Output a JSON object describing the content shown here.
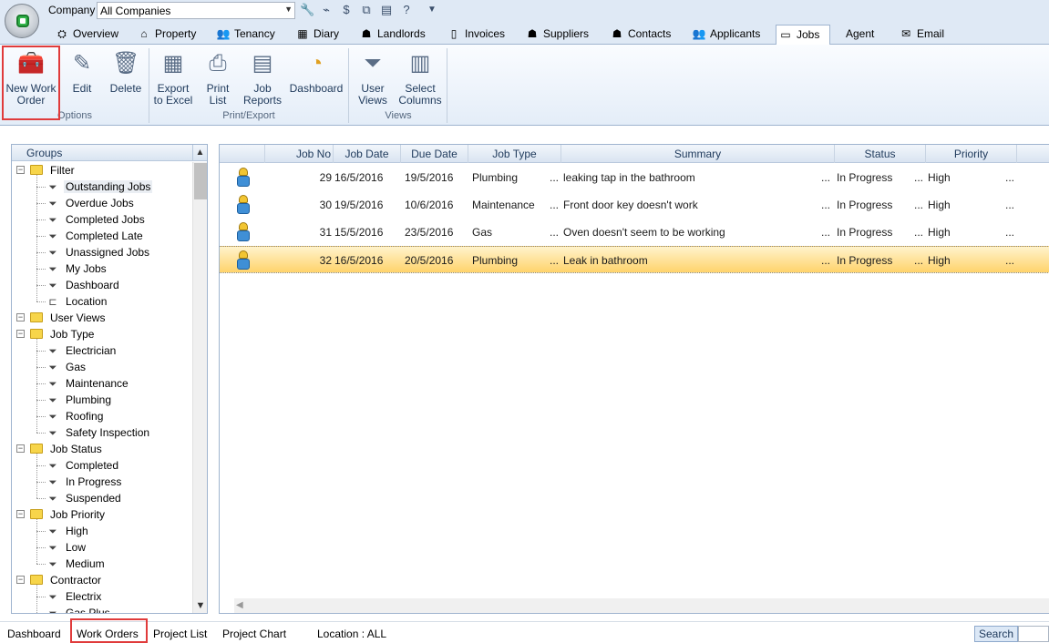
{
  "topbar": {
    "company_label": "Company",
    "company_value": "All Companies",
    "quick_access": [
      "wrench-icon",
      "tag-icon",
      "money-icon",
      "tree-icon",
      "document-icon",
      "help-icon",
      "customize-icon"
    ]
  },
  "tabs": [
    {
      "label": "Overview",
      "icon": "overview-icon"
    },
    {
      "label": "Property",
      "icon": "property-icon"
    },
    {
      "label": "Tenancy",
      "icon": "tenancy-icon"
    },
    {
      "label": "Diary",
      "icon": "diary-icon"
    },
    {
      "label": "Landlords",
      "icon": "landlords-icon"
    },
    {
      "label": "Invoices",
      "icon": "invoices-icon"
    },
    {
      "label": "Suppliers",
      "icon": "suppliers-icon"
    },
    {
      "label": "Contacts",
      "icon": "contacts-icon"
    },
    {
      "label": "Applicants",
      "icon": "applicants-icon"
    },
    {
      "label": "Jobs",
      "icon": "jobs-icon",
      "active": true
    },
    {
      "label": "Agent",
      "icon": ""
    },
    {
      "label": "Email",
      "icon": "email-icon"
    }
  ],
  "ribbon": {
    "new_work_order": "New Work\nOrder",
    "edit": "Edit",
    "delete": "Delete",
    "export_excel": "Export\nto Excel",
    "print_list": "Print\nList",
    "job_reports": "Job\nReports",
    "dashboard": "Dashboard",
    "user_views": "User\nViews",
    "select_columns": "Select\nColumns",
    "group_options": "Options",
    "group_print_export": "Print/Export",
    "group_views": "Views"
  },
  "groups": {
    "header": "Groups",
    "nodes": [
      {
        "label": "Filter",
        "type": "folder",
        "level": 0
      },
      {
        "label": "Outstanding Jobs",
        "type": "filter",
        "level": 1,
        "selected": true
      },
      {
        "label": "Overdue Jobs",
        "type": "filter",
        "level": 1
      },
      {
        "label": "Completed Jobs",
        "type": "filter",
        "level": 1
      },
      {
        "label": "Completed Late",
        "type": "filter",
        "level": 1
      },
      {
        "label": "Unassigned Jobs",
        "type": "filter",
        "level": 1
      },
      {
        "label": "My Jobs",
        "type": "filter",
        "level": 1
      },
      {
        "label": "Dashboard",
        "type": "filter",
        "level": 1
      },
      {
        "label": "Location",
        "type": "location",
        "level": 1
      },
      {
        "label": "User Views",
        "type": "folder",
        "level": 0
      },
      {
        "label": "Job Type",
        "type": "folder",
        "level": 0
      },
      {
        "label": "Electrician",
        "type": "filter",
        "level": 1
      },
      {
        "label": "Gas",
        "type": "filter",
        "level": 1
      },
      {
        "label": "Maintenance",
        "type": "filter",
        "level": 1
      },
      {
        "label": "Plumbing",
        "type": "filter",
        "level": 1
      },
      {
        "label": "Roofing",
        "type": "filter",
        "level": 1
      },
      {
        "label": "Safety Inspection",
        "type": "filter",
        "level": 1
      },
      {
        "label": "Job Status",
        "type": "folder",
        "level": 0
      },
      {
        "label": "Completed",
        "type": "filter",
        "level": 1
      },
      {
        "label": "In Progress",
        "type": "filter",
        "level": 1
      },
      {
        "label": "Suspended",
        "type": "filter",
        "level": 1
      },
      {
        "label": "Job Priority",
        "type": "folder",
        "level": 0
      },
      {
        "label": "High",
        "type": "filter",
        "level": 1
      },
      {
        "label": "Low",
        "type": "filter",
        "level": 1
      },
      {
        "label": "Medium",
        "type": "filter",
        "level": 1
      },
      {
        "label": "Contractor",
        "type": "folder",
        "level": 0
      },
      {
        "label": "Electrix",
        "type": "filter",
        "level": 1
      },
      {
        "label": "Gas Plus",
        "type": "filter",
        "level": 1
      }
    ]
  },
  "grid": {
    "columns": [
      "Job No",
      "Job Date",
      "Due Date",
      "Job Type",
      "Summary",
      "Status",
      "Priority"
    ],
    "rows": [
      {
        "job_no": "29",
        "job_date": "16/5/2016",
        "due_date": "19/5/2016",
        "job_type": "Plumbing",
        "summary": "leaking tap in the bathroom",
        "status": "In Progress",
        "priority": "High"
      },
      {
        "job_no": "30",
        "job_date": "19/5/2016",
        "due_date": "10/6/2016",
        "job_type": "Maintenance",
        "summary": "Front door key doesn't work",
        "status": "In Progress",
        "priority": "High"
      },
      {
        "job_no": "31",
        "job_date": "15/5/2016",
        "due_date": "23/5/2016",
        "job_type": "Gas",
        "summary": "Oven doesn't seem to be working",
        "status": "In Progress",
        "priority": "High"
      },
      {
        "job_no": "32",
        "job_date": "16/5/2016",
        "due_date": "20/5/2016",
        "job_type": "Plumbing",
        "summary": "Leak in bathroom",
        "status": "In Progress",
        "priority": "High",
        "selected": true
      }
    ],
    "ellipsis": "..."
  },
  "bottom": {
    "tabs": [
      "Dashboard",
      "Work Orders",
      "Project List",
      "Project Chart"
    ],
    "active_tab": "Work Orders",
    "location_status": "Location : ALL",
    "search_label": "Search"
  },
  "colors": {
    "accent": "#dfe9f5",
    "selected_row": "#ffd36b",
    "highlight": "#e03b3b"
  }
}
